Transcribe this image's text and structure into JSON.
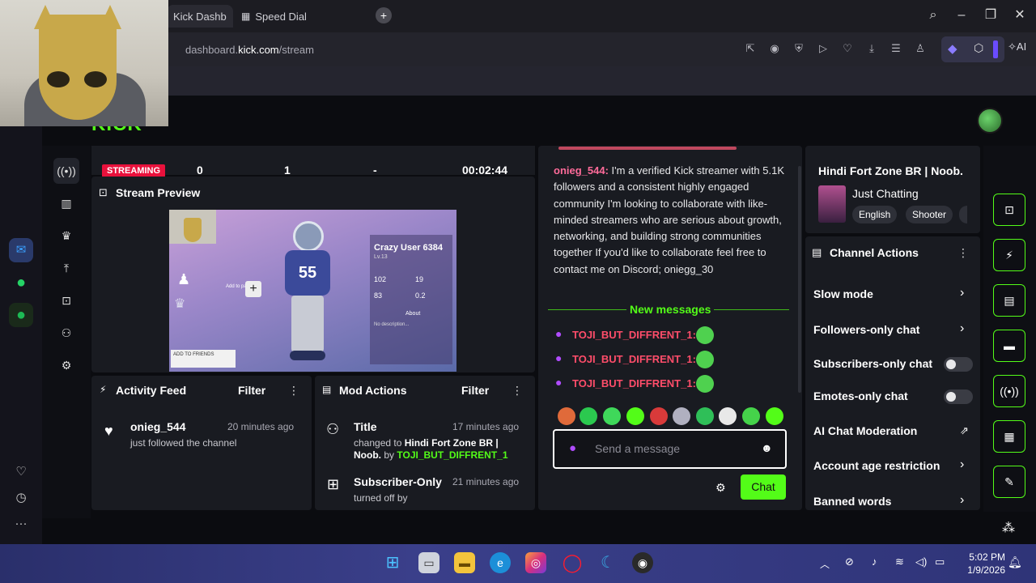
{
  "browser": {
    "tabs": [
      {
        "label": "Kick Dashboa"
      },
      {
        "label": "Speed Dial"
      }
    ],
    "url_prefix": "dashboard.",
    "url_domain": "kick.com",
    "url_path": "/stream",
    "ai_label": "AI"
  },
  "stats": {
    "live_label": "STREAMING",
    "viewers": "0",
    "followers": "1",
    "subs": "-",
    "duration": "00:02:44"
  },
  "preview": {
    "title": "Stream Preview",
    "player_name": "Crazy User 6384",
    "player_level": "Lv.13",
    "total_battles": "102",
    "total_victories": "19",
    "total_defeats": "83",
    "victories_defeats": "0.2",
    "about": "About",
    "no_desc": "No description...",
    "add_friends": "ADD TO FRIENDS",
    "add_party": "Add to party",
    "jersey_number": "55"
  },
  "activity": {
    "title": "Activity Feed",
    "filter": "Filter",
    "items": [
      {
        "user": "onieg_544",
        "time": "20 minutes ago",
        "text": "just followed the channel"
      }
    ]
  },
  "mod": {
    "title": "Mod Actions",
    "filter": "Filter",
    "items": [
      {
        "title": "Title",
        "time": "17 minutes ago",
        "prefix": "changed to",
        "value": "Hindi Fort Zone BR | Noob.",
        "by": "by",
        "user": "TOJI_BUT_DIFFRENT_1"
      },
      {
        "title": "Subscriber-Only",
        "time": "21 minutes ago",
        "text": "turned off by"
      }
    ]
  },
  "chat": {
    "msg_user": "onieg_544:",
    "msg_text": "I'm a verified Kick streamer with 5.1K followers and a consistent highly engaged community I'm looking to collaborate with like-minded streamers who are serious about growth, networking, and building strong communities together If you'd like to collaborate feel free to contact me on Discord; oniegg_30",
    "new_messages": "New messages",
    "lines": [
      {
        "user": "TOJI_BUT_DIFFRENT_1:"
      },
      {
        "user": "TOJI_BUT_DIFFRENT_1:"
      },
      {
        "user": "TOJI_BUT_DIFFRENT_1:"
      }
    ],
    "input_placeholder": "Send a message",
    "send_label": "Chat"
  },
  "stream_info": {
    "title": "Hindi Fort Zone BR | Noob.",
    "category": "Just Chatting",
    "tags": [
      "English",
      "Shooter"
    ]
  },
  "channel_actions": {
    "title": "Channel Actions",
    "rows": [
      {
        "label": "Slow mode"
      },
      {
        "label": "Followers-only chat"
      },
      {
        "label": "Subscribers-only chat"
      },
      {
        "label": "Emotes-only chat"
      },
      {
        "label": "AI Chat Moderation"
      },
      {
        "label": "Account age restriction"
      },
      {
        "label": "Banned words"
      }
    ]
  },
  "taskbar": {
    "time": "5:02 PM",
    "date": "1/9/2026"
  },
  "colors": {
    "kick_green": "#53fc18",
    "live_red": "#e9113c",
    "panel_bg": "#191b21"
  }
}
